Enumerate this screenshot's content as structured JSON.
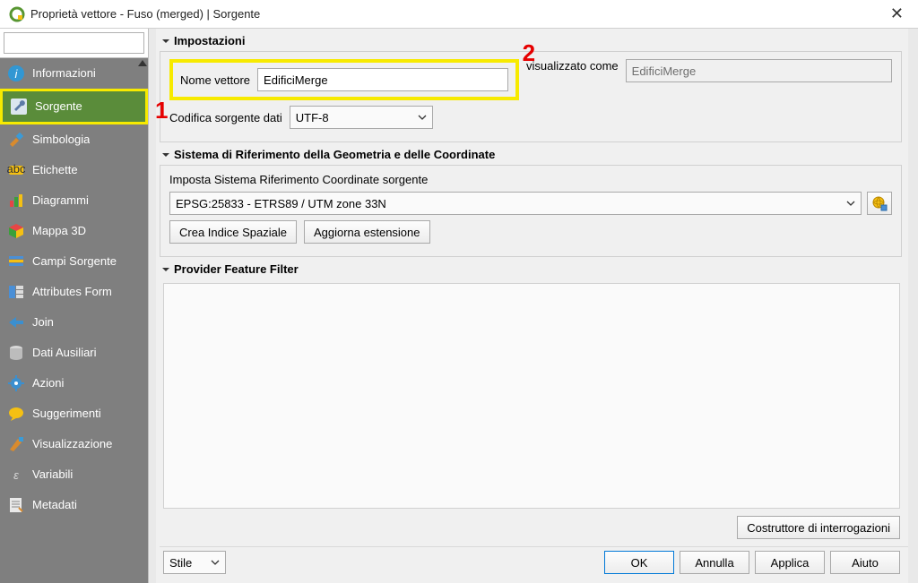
{
  "window": {
    "title": "Proprietà vettore - Fuso (merged) | Sorgente"
  },
  "annotations": {
    "one": "1",
    "two": "2"
  },
  "sidebar": {
    "search_placeholder": "",
    "items": [
      {
        "label": "Informazioni"
      },
      {
        "label": "Sorgente"
      },
      {
        "label": "Simbologia"
      },
      {
        "label": "Etichette"
      },
      {
        "label": "Diagrammi"
      },
      {
        "label": "Mappa 3D"
      },
      {
        "label": "Campi Sorgente"
      },
      {
        "label": "Attributes Form"
      },
      {
        "label": "Join"
      },
      {
        "label": "Dati Ausiliari"
      },
      {
        "label": "Azioni"
      },
      {
        "label": "Suggerimenti"
      },
      {
        "label": "Visualizzazione"
      },
      {
        "label": "Variabili"
      },
      {
        "label": "Metadati"
      }
    ]
  },
  "settings": {
    "header": "Impostazioni",
    "name_label": "Nome vettore",
    "name_value": "EdificiMerge",
    "displayed_as_label": "visualizzato come",
    "displayed_as_value": "EdificiMerge",
    "encoding_label": "Codifica sorgente dati",
    "encoding_value": "UTF-8"
  },
  "crs": {
    "header": "Sistema di Riferimento della Geometria e delle Coordinate",
    "set_label": "Imposta Sistema Riferimento Coordinate sorgente",
    "value": "EPSG:25833 - ETRS89 / UTM zone 33N",
    "btn_spatial_index": "Crea Indice Spaziale",
    "btn_update_extent": "Aggiorna estensione"
  },
  "filter": {
    "header": "Provider Feature Filter",
    "query_builder": "Costruttore di interrogazioni"
  },
  "bottom": {
    "style": "Stile",
    "ok": "OK",
    "cancel": "Annulla",
    "apply": "Applica",
    "help": "Aiuto"
  }
}
